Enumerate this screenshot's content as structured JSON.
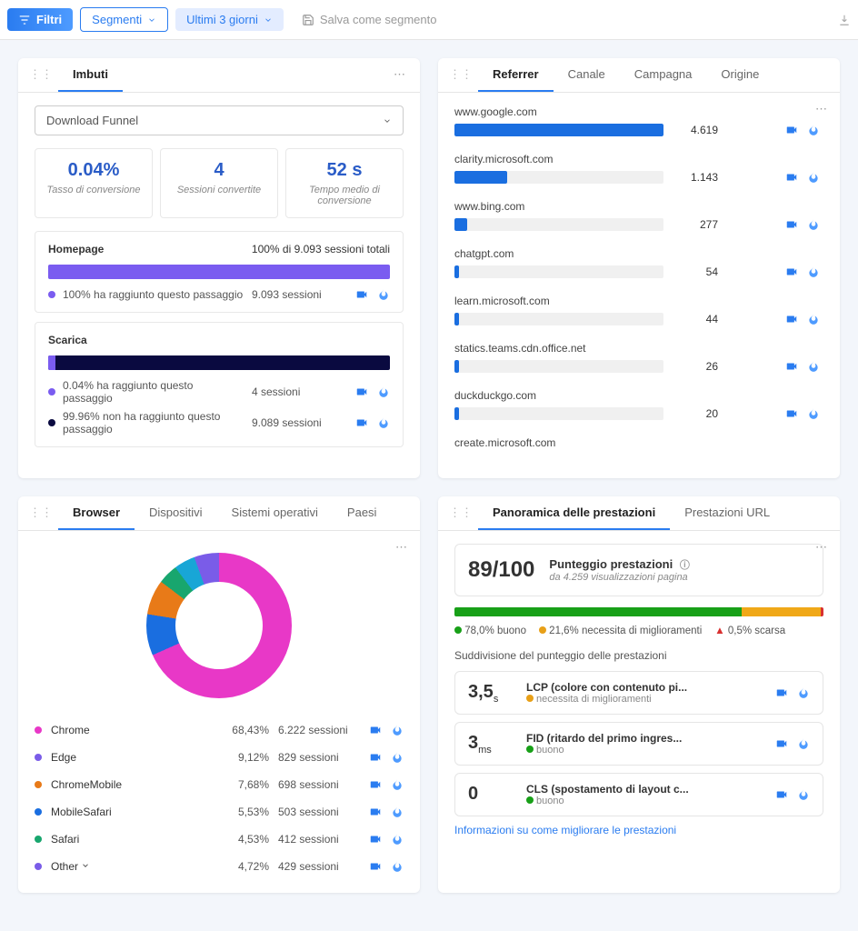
{
  "toolbar": {
    "filter_label": "Filtri",
    "segments_label": "Segmenti",
    "timerange_label": "Ultimi 3 giorni",
    "save_segment_label": "Salva come segmento"
  },
  "funnel_card": {
    "tab": "Imbuti",
    "selector_label": "Download Funnel",
    "metrics": [
      {
        "value": "0.04%",
        "label": "Tasso di conversione"
      },
      {
        "value": "4",
        "label": "Sessioni convertite"
      },
      {
        "value": "52 s",
        "label": "Tempo medio di conversione"
      }
    ],
    "steps": [
      {
        "title": "Homepage",
        "right": "100% di 9.093 sessioni totali",
        "fill_pct": 100,
        "fill_color": "#7a5cf0",
        "rows": [
          {
            "dot": "#7a5cf0",
            "text": "100% ha raggiunto questo passaggio",
            "sessions": "9.093 sessioni"
          }
        ]
      },
      {
        "title": "Scarica",
        "right": "",
        "fill_pct": 100,
        "fill_color": "#0a0a40",
        "fill_inner_pct": 2,
        "rows": [
          {
            "dot": "#7a5cf0",
            "text": "0.04% ha raggiunto questo passaggio",
            "sessions": "4 sessioni"
          },
          {
            "dot": "#0a0a40",
            "text": "99.96% non ha raggiunto questo passaggio",
            "sessions": "9.089 sessioni"
          }
        ]
      }
    ]
  },
  "referrer_card": {
    "tabs": [
      "Referrer",
      "Canale",
      "Campagna",
      "Origine"
    ],
    "items": [
      {
        "name": "www.google.com",
        "value": "4.619",
        "pct": 100
      },
      {
        "name": "clarity.microsoft.com",
        "value": "1.143",
        "pct": 25
      },
      {
        "name": "www.bing.com",
        "value": "277",
        "pct": 6
      },
      {
        "name": "chatgpt.com",
        "value": "54",
        "pct": 2
      },
      {
        "name": "learn.microsoft.com",
        "value": "44",
        "pct": 2
      },
      {
        "name": "statics.teams.cdn.office.net",
        "value": "26",
        "pct": 2
      },
      {
        "name": "duckduckgo.com",
        "value": "20",
        "pct": 2
      },
      {
        "name": "create.microsoft.com",
        "value": "",
        "pct": 0
      }
    ]
  },
  "browser_card": {
    "tabs": [
      "Browser",
      "Dispositivi",
      "Sistemi operativi",
      "Paesi"
    ],
    "rows": [
      {
        "name": "Chrome",
        "pct": "68,43%",
        "sessions": "6.222 sessioni",
        "color": "#e838c7"
      },
      {
        "name": "Edge",
        "pct": "9,12%",
        "sessions": "829 sessioni",
        "color": "#7a5ce8"
      },
      {
        "name": "ChromeMobile",
        "pct": "7,68%",
        "sessions": "698 sessioni",
        "color": "#e87a18"
      },
      {
        "name": "MobileSafari",
        "pct": "5,53%",
        "sessions": "503 sessioni",
        "color": "#1a6ee0"
      },
      {
        "name": "Safari",
        "pct": "4,53%",
        "sessions": "412 sessioni",
        "color": "#18a66e"
      },
      {
        "name": "Other",
        "pct": "4,72%",
        "sessions": "429 sessioni",
        "color": "#7a5ce8",
        "expandable": true
      }
    ]
  },
  "chart_data": {
    "type": "pie",
    "title": "Browser",
    "series": [
      {
        "name": "Chrome",
        "value": 68.43,
        "color": "#e838c7"
      },
      {
        "name": "Edge",
        "value": 9.12,
        "color": "#7a5ce8"
      },
      {
        "name": "ChromeMobile",
        "value": 7.68,
        "color": "#e87a18"
      },
      {
        "name": "MobileSafari",
        "value": 5.53,
        "color": "#1a6ee0"
      },
      {
        "name": "Safari",
        "value": 4.53,
        "color": "#18a66e"
      },
      {
        "name": "Other",
        "value": 4.72,
        "color": "#18a6d6"
      }
    ]
  },
  "perf_card": {
    "tabs": [
      "Panoramica delle prestazioni",
      "Prestazioni URL"
    ],
    "score": "89/100",
    "score_label": "Punteggio prestazioni",
    "score_sub": "da 4.259 visualizzazioni pagina",
    "legend": [
      {
        "color": "#18a018",
        "text": "78,0% buono"
      },
      {
        "color": "#e8a018",
        "text": "21,6% necessita di miglioramenti"
      },
      {
        "color": "#d83030",
        "text": "0,5% scarsa",
        "triangle": true
      }
    ],
    "breakdown_label": "Suddivisione del punteggio delle prestazioni",
    "metrics": [
      {
        "val": "3,5",
        "unit": "s",
        "title": "LCP (colore con contenuto pi...",
        "sub": "necessita di miglioramenti",
        "dot": "#e8a018"
      },
      {
        "val": "3",
        "unit": "ms",
        "title": "FID (ritardo del primo ingres...",
        "sub": "buono",
        "dot": "#18a018"
      },
      {
        "val": "0",
        "unit": "",
        "title": "CLS (spostamento di layout c...",
        "sub": "buono",
        "dot": "#18a018"
      }
    ],
    "link": "Informazioni su come migliorare le prestazioni"
  }
}
